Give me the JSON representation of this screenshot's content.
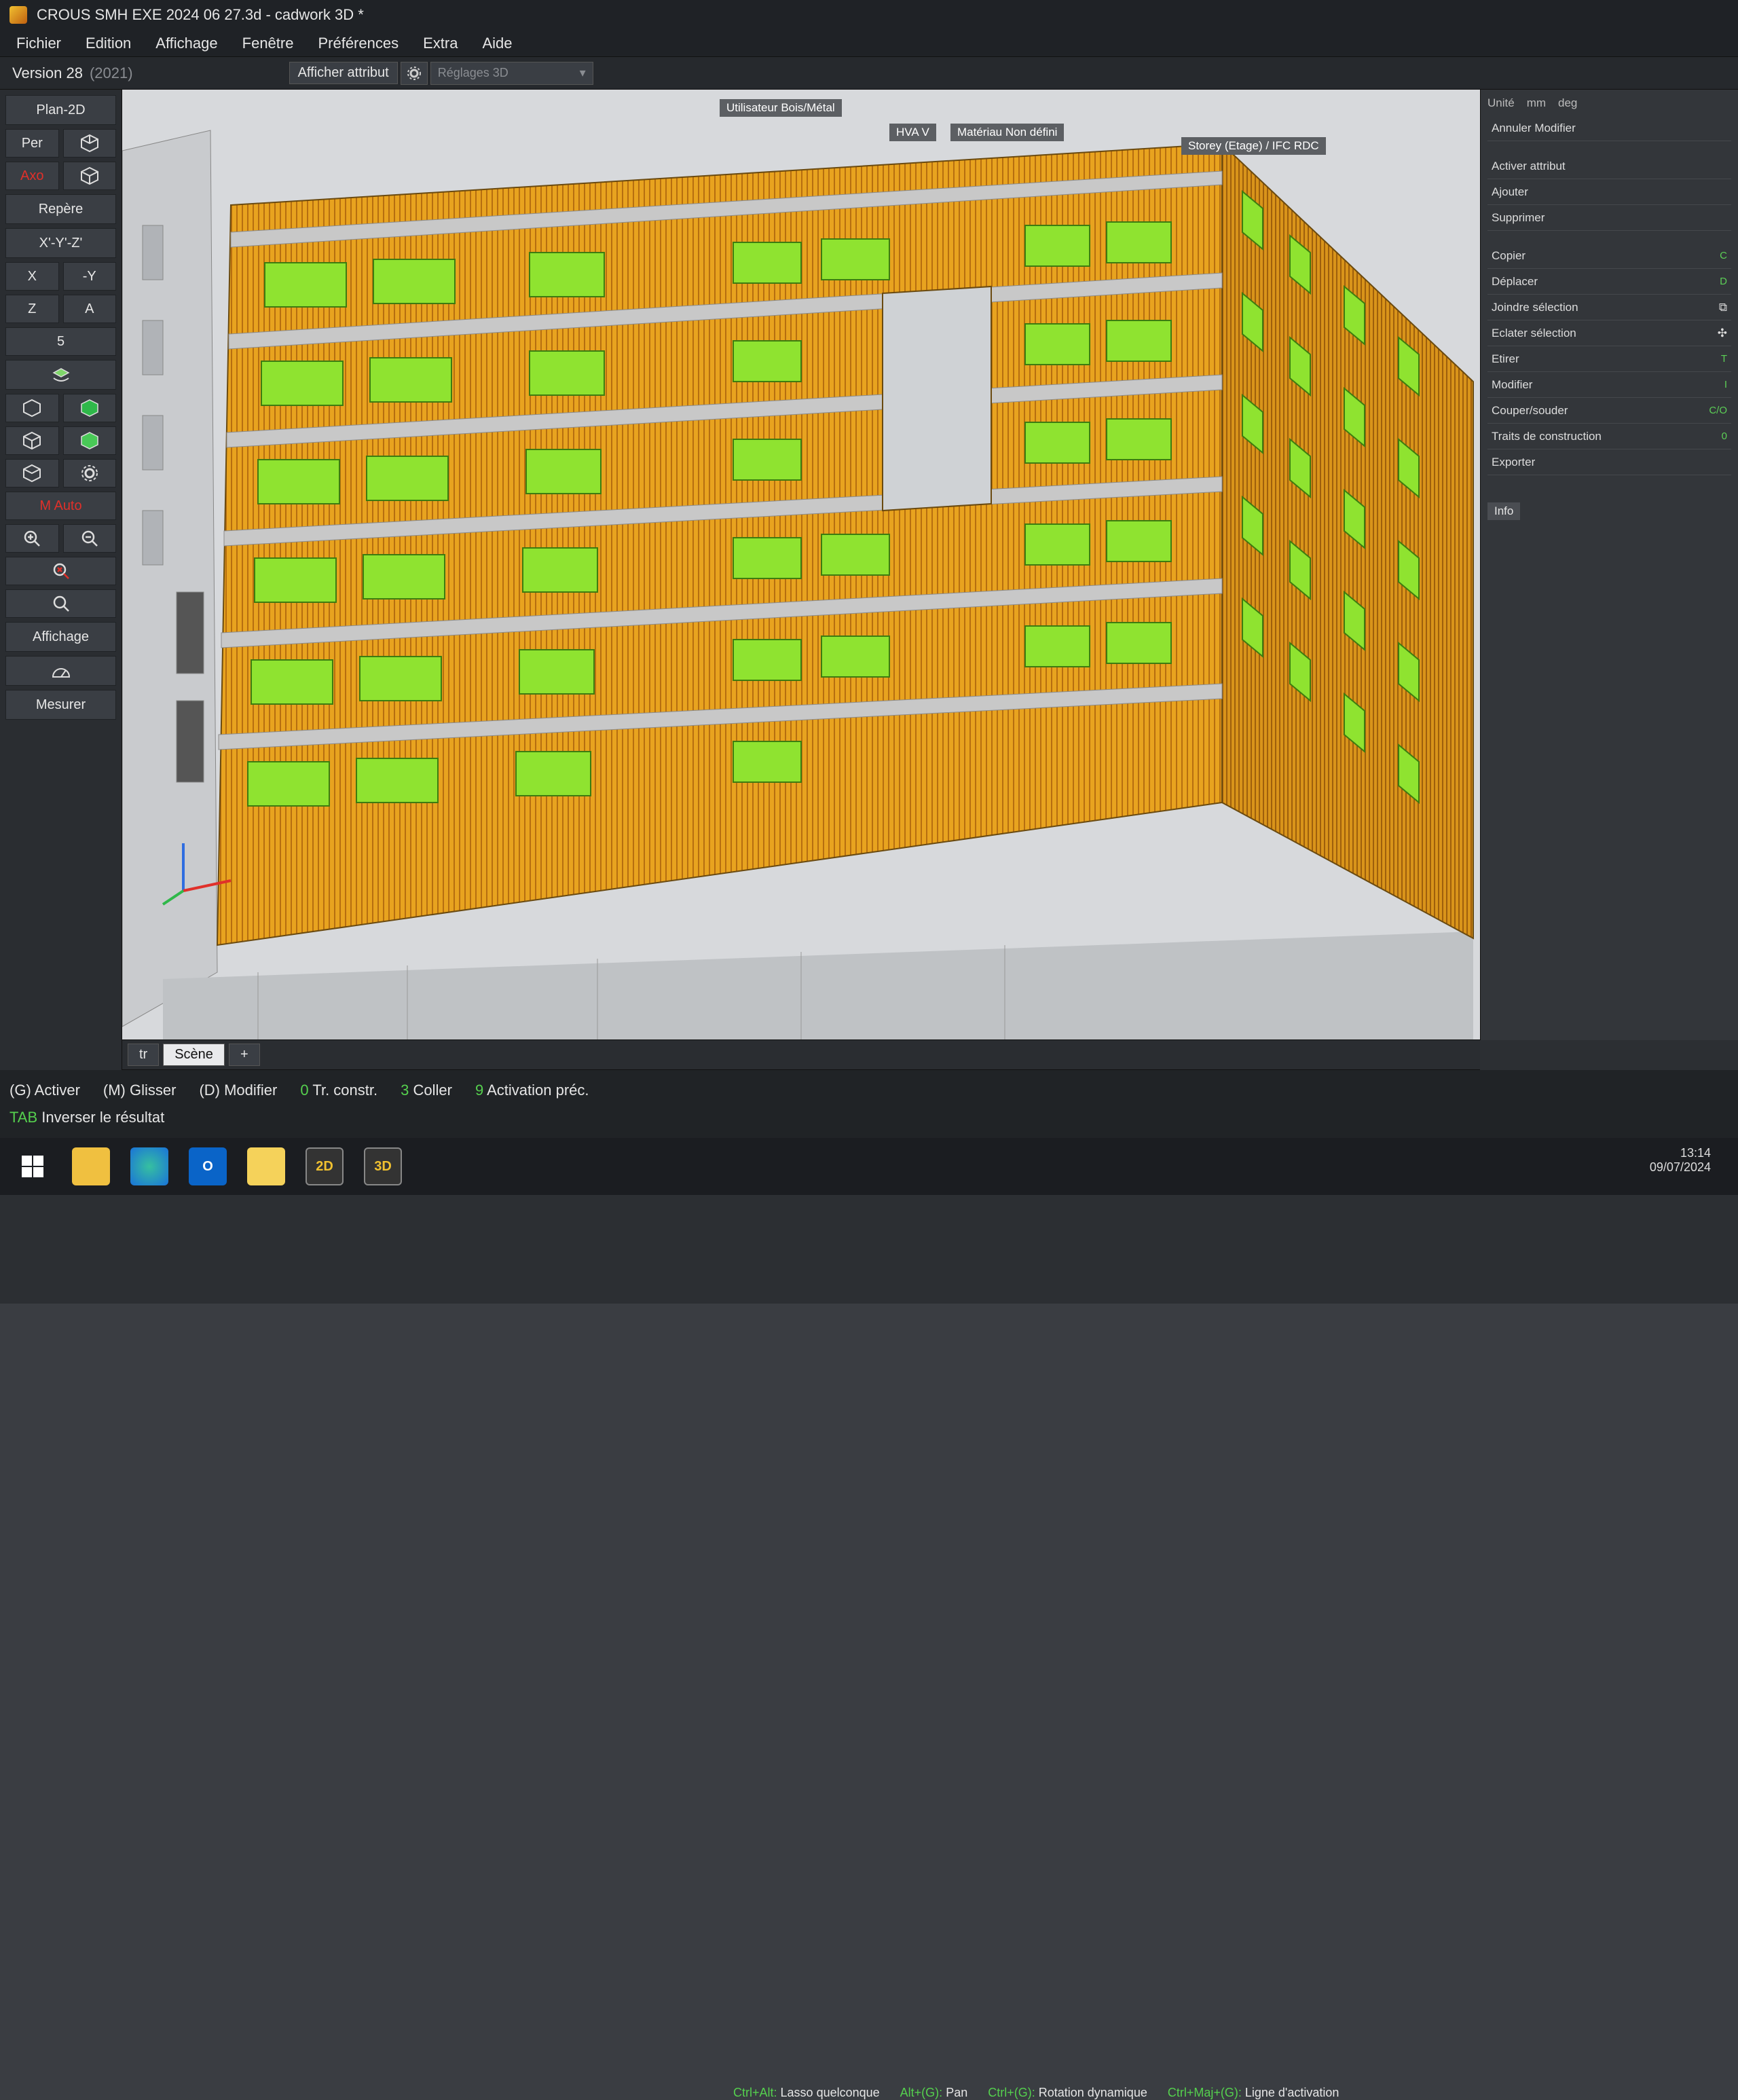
{
  "window": {
    "title": "CROUS SMH EXE 2024 06 27.3d - cadwork 3D *"
  },
  "menu": [
    "Fichier",
    "Edition",
    "Affichage",
    "Fenêtre",
    "Préférences",
    "Extra",
    "Aide"
  ],
  "version": {
    "label": "Version 28",
    "year": "(2021)"
  },
  "toolbar_top": {
    "attr_button": "Afficher attribut",
    "settings_placeholder": "Réglages 3D"
  },
  "left_toolbar": {
    "plan2d": "Plan-2D",
    "per": "Per",
    "axo": "Axo",
    "repere": "Repère",
    "xyz": "X'-Y'-Z'",
    "x": "X",
    "neg_y": "-Y",
    "z": "Z",
    "a": "A",
    "five": "5",
    "auto": "M Auto",
    "affichage": "Affichage",
    "mesurer": "Mesurer"
  },
  "viewport": {
    "user_label": "Utilisateur",
    "user_value": "Bois/Métal",
    "hva": "HVA",
    "hva_value": "V",
    "material_label": "Matériau",
    "material_value": "Non défini",
    "storey": "Storey (Etage) / IFC RDC"
  },
  "right_panel": {
    "units": [
      "Unité",
      "mm",
      "deg"
    ],
    "undo": "Annuler Modifier",
    "group1": [
      "Activer attribut",
      "Ajouter",
      "Supprimer"
    ],
    "group2": [
      {
        "label": "Copier",
        "shortcut": "C"
      },
      {
        "label": "Déplacer",
        "shortcut": "D"
      },
      {
        "label": "Joindre sélection",
        "shortcut": ""
      },
      {
        "label": "Eclater sélection",
        "shortcut": ""
      },
      {
        "label": "Etirer",
        "shortcut": "T"
      },
      {
        "label": "Modifier",
        "shortcut": "I"
      },
      {
        "label": "Couper/souder",
        "shortcut": "C/O"
      },
      {
        "label": "Traits de construction",
        "shortcut": "0"
      },
      {
        "label": "Exporter",
        "shortcut": ""
      }
    ],
    "info": "Info"
  },
  "tabs": [
    "tr",
    "Scène",
    "+"
  ],
  "hints": {
    "lasso_key": "Ctrl+Alt:",
    "lasso": "Lasso quelconque",
    "pan_key": "Alt+(G):",
    "pan": "Pan",
    "rot_key": "Ctrl+(G):",
    "rot": "Rotation dynamique",
    "line_key": "Ctrl+Maj+(G):",
    "line": "Ligne d'activation"
  },
  "status": {
    "activer": "(G) Activer",
    "glisser": "(M) Glisser",
    "modifier": "(D) Modifier",
    "k0": "0",
    "tr_constr": "Tr. constr.",
    "k3": "3",
    "coller": "Coller",
    "k9": "9",
    "activation": "Activation préc.",
    "tab_key": "TAB",
    "inverser": "Inverser le résultat"
  },
  "taskbar": {
    "apps": [
      "windows-start",
      "file-explorer",
      "edge",
      "outlook",
      "notes",
      "cadwork-2d",
      "cadwork-3d"
    ],
    "app2d": "2D",
    "app3d": "3D"
  },
  "tray": {
    "time": "13:14",
    "date": "09/07/2024"
  },
  "colors": {
    "facade": "#e8a31f",
    "window": "#8fe330",
    "status_green": "#55d04e"
  }
}
